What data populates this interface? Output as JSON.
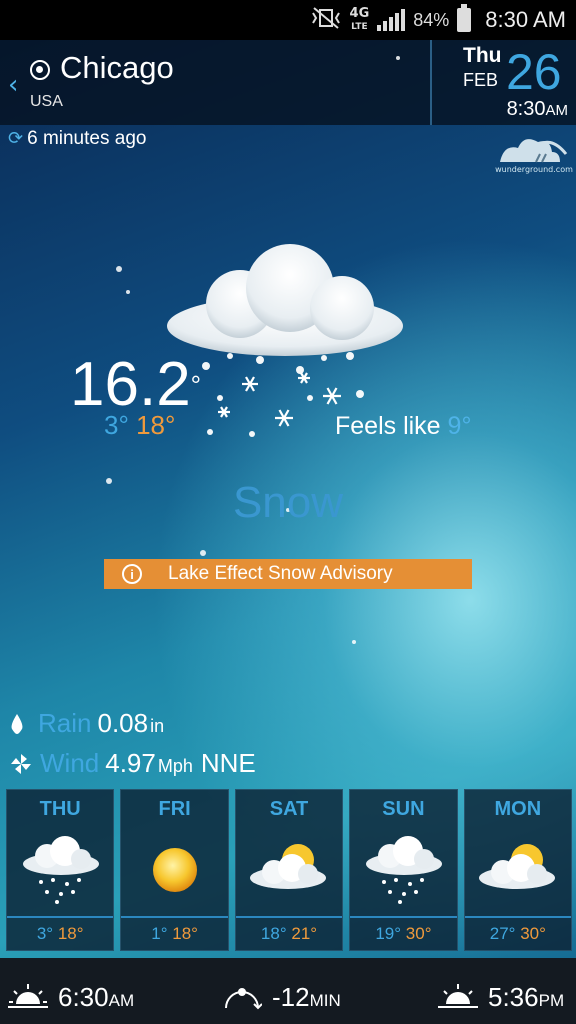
{
  "status_bar": {
    "network": "4G",
    "network_sub": "LTE",
    "battery": "84%",
    "time": "8:30 AM",
    "icons": [
      "mute-vibrate-icon",
      "network-4g-icon",
      "signal-icon",
      "battery-icon"
    ]
  },
  "header": {
    "city": "Chicago",
    "country": "USA",
    "day": "Thu",
    "month": "FEB",
    "date": "26",
    "time": "8:30",
    "ampm": "AM"
  },
  "updated": "6 minutes ago",
  "provider": "wunderground.com",
  "current": {
    "temp": "16.2",
    "deg": "°",
    "low": "3°",
    "high": "18°",
    "feels_label": "Feels like",
    "feels_value": "9°",
    "condition": "Snow",
    "advisory": "Lake Effect Snow Advisory"
  },
  "details": {
    "rain_label": "Rain",
    "rain_value": "0.08",
    "rain_unit": "in",
    "wind_label": "Wind",
    "wind_value": "4.97",
    "wind_unit": "Mph",
    "wind_dir": "NNE"
  },
  "forecast": [
    {
      "day": "THU",
      "low": "3°",
      "high": "18°",
      "icon": "snow-icon"
    },
    {
      "day": "FRI",
      "low": "1°",
      "high": "18°",
      "icon": "sun-icon"
    },
    {
      "day": "SAT",
      "low": "18°",
      "high": "21°",
      "icon": "partly-cloudy-icon"
    },
    {
      "day": "SUN",
      "low": "19°",
      "high": "30°",
      "icon": "snow-icon"
    },
    {
      "day": "MON",
      "low": "27°",
      "high": "30°",
      "icon": "partly-cloudy-icon"
    }
  ],
  "bottom": {
    "sunrise_time": "6:30",
    "sunrise_ampm": "AM",
    "daylight_change": "-12",
    "daylight_unit": "MIN",
    "sunset_time": "5:36",
    "sunset_ampm": "PM"
  },
  "colors": {
    "accent_blue": "#3fa7e0",
    "accent_orange": "#ef9a3c",
    "advisory_bg": "#e58f35"
  }
}
